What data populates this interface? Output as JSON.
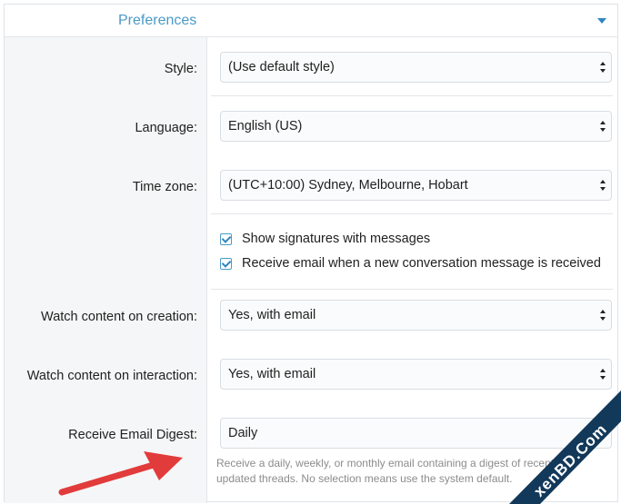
{
  "section": {
    "title": "Preferences"
  },
  "fields": [
    {
      "label": "Style:",
      "value": "(Use default style)"
    },
    {
      "label": "Language:",
      "value": "English (US)"
    },
    {
      "label": "Time zone:",
      "value": "(UTC+10:00) Sydney, Melbourne, Hobart"
    },
    {
      "label": "Watch content on creation:",
      "value": "Yes, with email"
    },
    {
      "label": "Watch content on interaction:",
      "value": "Yes, with email"
    },
    {
      "label": "Receive Email Digest:",
      "value": "Daily"
    }
  ],
  "checkboxes": [
    {
      "label": "Show signatures with messages",
      "checked": true
    },
    {
      "label": "Receive email when a new conversation message is received",
      "checked": true
    }
  ],
  "digest_hint": "Receive a daily, weekly, or monthly email containing a digest of recently updated threads. No selection means use the system default.",
  "watermark": {
    "text": "xenBD.Com"
  },
  "colors": {
    "accent": "#4a9ac7",
    "arrow": "#e23b3b",
    "label_bg": "#f5f6f7",
    "watermark_bg": "#12385a"
  }
}
